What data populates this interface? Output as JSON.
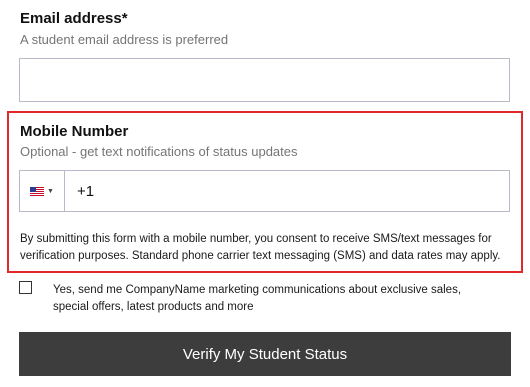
{
  "email": {
    "label": "Email address*",
    "hint": "A student email address is preferred",
    "value": ""
  },
  "mobile": {
    "label": "Mobile Number",
    "hint": "Optional - get text notifications of status updates",
    "country_flag_icon": "us-flag-icon",
    "country_caret_icon": "caret-down-icon",
    "value": "+1",
    "consent": "By submitting this form with a mobile number, you consent to receive SMS/text messages for verification purposes. Standard phone carrier text messaging (SMS) and data rates may apply."
  },
  "marketing": {
    "checked": false,
    "label": "Yes, send me CompanyName marketing communications about exclusive sales, special offers, latest products and more"
  },
  "submit": {
    "label": "Verify My Student Status"
  },
  "colors": {
    "highlight_border": "#e02a2a",
    "button_bg": "#3d3d3d",
    "input_border": "#b9b9c9",
    "hint_text": "#757575"
  }
}
